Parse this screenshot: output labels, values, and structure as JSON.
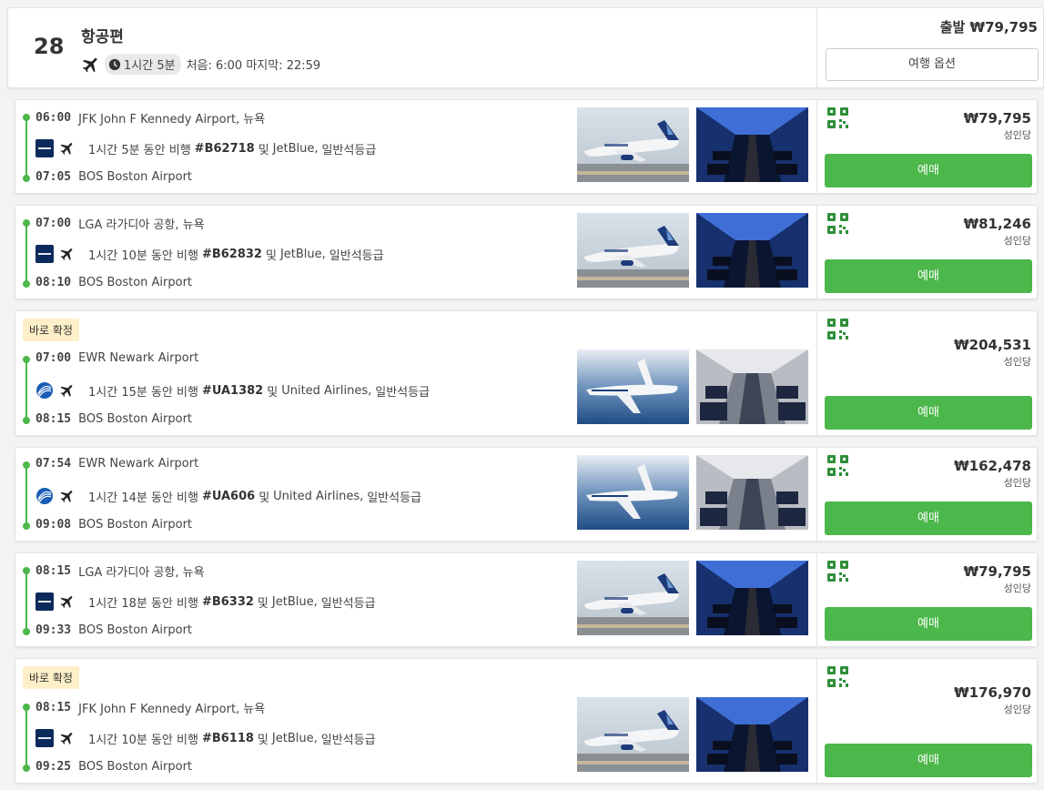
{
  "header": {
    "count": "28",
    "title": "항공편",
    "duration": "1시간 5분",
    "first_last": "처음: 6:00 마지막: 22:59",
    "price_label": "출발 ₩79,795",
    "trip_options_label": "여행 옵션"
  },
  "flights": [
    {
      "badge": "",
      "dep_time": "06:00",
      "dep_airport": "JFK John F Kennedy Airport, 뉴욕",
      "duration": "1시간 5분 동안 비행",
      "flight_no": "#B62718",
      "conj": "및",
      "airline": "JetBlue,",
      "cabin": "일반석등급",
      "arr_time": "07:05",
      "arr_airport": "BOS Boston Airport",
      "airline_logo": "jetblue-logo",
      "price": "₩79,795",
      "per_adult": "성인당",
      "book_label": "예매"
    },
    {
      "badge": "",
      "dep_time": "07:00",
      "dep_airport": "LGA 라가디아 공항, 뉴욕",
      "duration": "1시간 10분 동안 비행",
      "flight_no": "#B62832",
      "conj": "및",
      "airline": "JetBlue,",
      "cabin": "일반석등급",
      "arr_time": "08:10",
      "arr_airport": "BOS Boston Airport",
      "airline_logo": "jetblue-logo",
      "price": "₩81,246",
      "per_adult": "성인당",
      "book_label": "예매"
    },
    {
      "badge": "바로 확정",
      "dep_time": "07:00",
      "dep_airport": "EWR Newark Airport",
      "duration": "1시간 15분 동안 비행",
      "flight_no": "#UA1382",
      "conj": "및",
      "airline": "United Airlines,",
      "cabin": "일반석등급",
      "arr_time": "08:15",
      "arr_airport": "BOS Boston Airport",
      "airline_logo": "united-logo",
      "price": "₩204,531",
      "per_adult": "성인당",
      "book_label": "예매"
    },
    {
      "badge": "",
      "dep_time": "07:54",
      "dep_airport": "EWR Newark Airport",
      "duration": "1시간 14분 동안 비행",
      "flight_no": "#UA606",
      "conj": "및",
      "airline": "United Airlines,",
      "cabin": "일반석등급",
      "arr_time": "09:08",
      "arr_airport": "BOS Boston Airport",
      "airline_logo": "united-logo",
      "price": "₩162,478",
      "per_adult": "성인당",
      "book_label": "예매"
    },
    {
      "badge": "",
      "dep_time": "08:15",
      "dep_airport": "LGA 라가디아 공항, 뉴욕",
      "duration": "1시간 18분 동안 비행",
      "flight_no": "#B6332",
      "conj": "및",
      "airline": "JetBlue,",
      "cabin": "일반석등급",
      "arr_time": "09:33",
      "arr_airport": "BOS Boston Airport",
      "airline_logo": "jetblue-logo",
      "price": "₩79,795",
      "per_adult": "성인당",
      "book_label": "예매"
    },
    {
      "badge": "바로 확정",
      "dep_time": "08:15",
      "dep_airport": "JFK John F Kennedy Airport, 뉴욕",
      "duration": "1시간 10분 동안 비행",
      "flight_no": "#B6118",
      "conj": "및",
      "airline": "JetBlue,",
      "cabin": "일반석등급",
      "arr_time": "09:25",
      "arr_airport": "BOS Boston Airport",
      "airline_logo": "jetblue-logo",
      "price": "₩176,970",
      "per_adult": "성인당",
      "book_label": "예매"
    }
  ],
  "colors": {
    "accent_green": "#4cb74a",
    "badge_bg": "#fdf0c8",
    "jetblue_navy": "#0b2a5b",
    "united_blue": "#1a5db5"
  },
  "icons": [
    "plane-icon",
    "clock-icon",
    "qr-code-icon",
    "jetblue-logo",
    "united-logo"
  ]
}
